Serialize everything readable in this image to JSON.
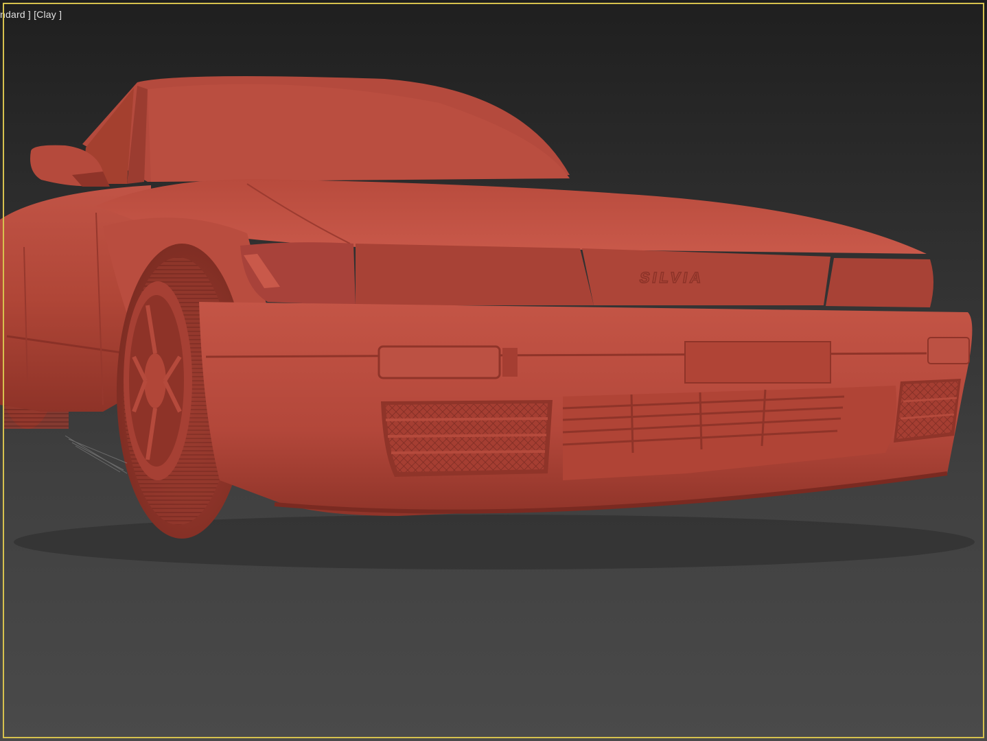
{
  "viewport": {
    "label_shading": "ndard ]",
    "label_style": "[Clay ]",
    "frame_color": "#d7c24e",
    "clay_color": "#b5483c",
    "emblem_text": "SILVIA"
  }
}
